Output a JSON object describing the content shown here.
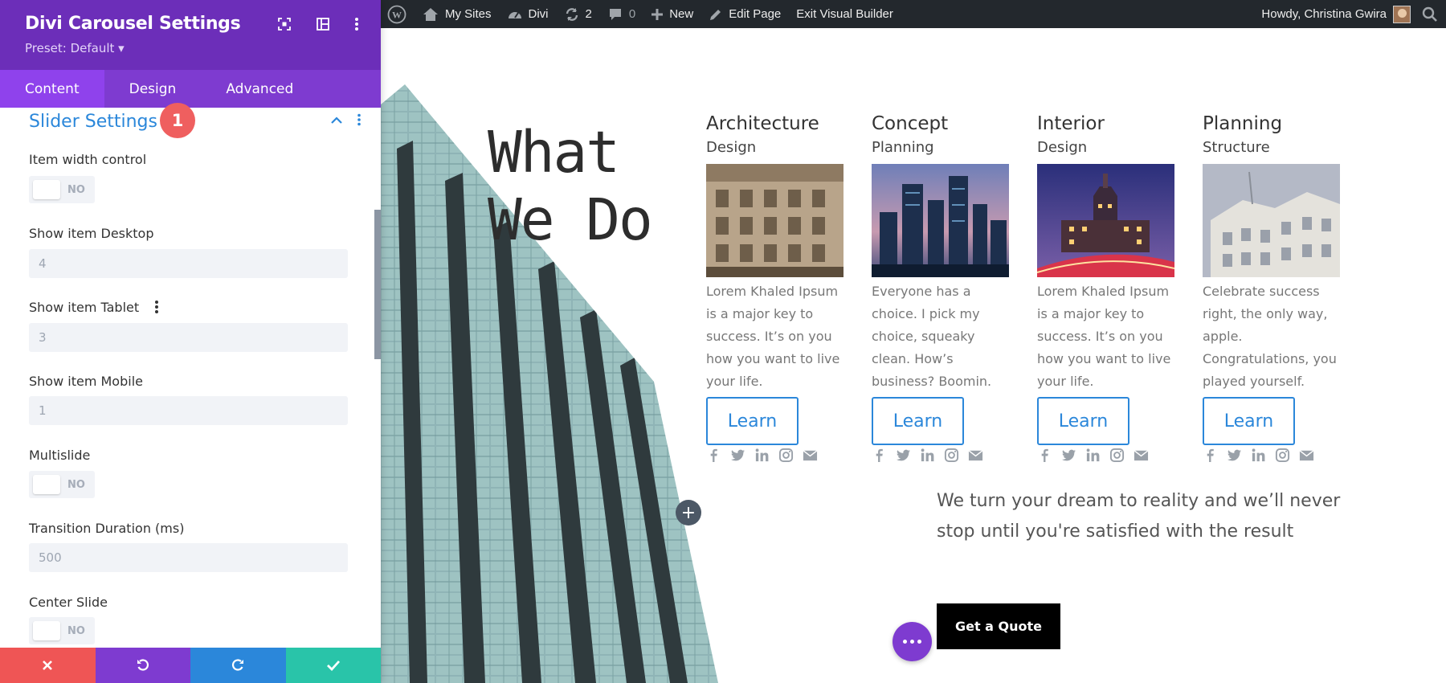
{
  "panel": {
    "title": "Divi Carousel Settings",
    "preset": "Preset: Default ▾",
    "header_colors": {
      "bar": "#6c2eb9",
      "tabs": "#7e3bd0",
      "active_tab": "#8f42ec"
    },
    "tabs": [
      {
        "label": "Content",
        "active": true
      },
      {
        "label": "Design",
        "active": false
      },
      {
        "label": "Advanced",
        "active": false
      }
    ],
    "section": {
      "title": "Slider Settings",
      "step_badge": "1"
    },
    "fields": {
      "item_width_control": {
        "label": "Item width control",
        "state": "NO"
      },
      "show_item_desktop": {
        "label": "Show item Desktop",
        "value": "4"
      },
      "show_item_tablet": {
        "label": "Show item Tablet",
        "value": "3"
      },
      "show_item_mobile": {
        "label": "Show item Mobile",
        "value": "1"
      },
      "multislide": {
        "label": "Multislide",
        "state": "NO"
      },
      "transition_duration": {
        "label": "Transition Duration (ms)",
        "value": "500"
      },
      "center_slide": {
        "label": "Center Slide",
        "state": "NO"
      }
    },
    "footer_colors": {
      "discard": "#ef5555",
      "undo": "#7e3bd0",
      "redo": "#2b87da",
      "save": "#29c4a9"
    }
  },
  "adminbar": {
    "my_sites": "My Sites",
    "divi": "Divi",
    "updates_count": "2",
    "comments_count": "0",
    "new": "New",
    "edit_page": "Edit Page",
    "exit_builder": "Exit Visual Builder",
    "howdy": "Howdy, Christina Gwira"
  },
  "page": {
    "hero_title_line1": "What",
    "hero_title_line2": "We Do",
    "cards": [
      {
        "title": "Architecture",
        "subtitle": "Design",
        "text": "Lorem Khaled Ipsum is a major key to success. It’s on you how you want to live your life.",
        "button": "Learn"
      },
      {
        "title": "Concept",
        "subtitle": "Planning",
        "text": "Everyone has a choice. I pick my choice, squeaky clean. How’s business? Boomin.",
        "button": "Learn"
      },
      {
        "title": "Interior",
        "subtitle": "Design",
        "text": "Lorem Khaled Ipsum is a major key to success. It’s on you how you want to live your life.",
        "button": "Learn"
      },
      {
        "title": "Planning",
        "subtitle": "Structure",
        "text": "Celebrate success right, the only way, apple. Congratulations, you played yourself.",
        "button": "Learn"
      }
    ],
    "tagline": "We turn your dream to reality and we’ll never stop until you're satisfied with the result",
    "cta_button": "Get a Quote",
    "accent_color": "#2b87da"
  }
}
